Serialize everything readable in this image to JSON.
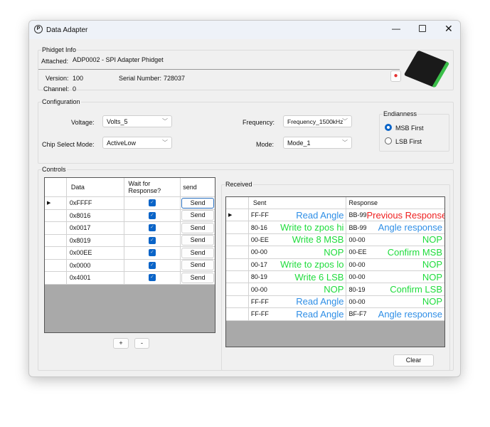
{
  "window": {
    "title": "Data Adapter",
    "controls": [
      "minimize",
      "maximize",
      "close"
    ]
  },
  "phidget_info": {
    "title": "Phidget Info",
    "attached_label": "Attached:",
    "attached": "ADP0002 - SPI Adapter Phidget",
    "version_label": "Version:",
    "version": "100",
    "serial_label": "Serial Number:",
    "serial": "728037",
    "channel_label": "Channel:",
    "channel": "0"
  },
  "configuration": {
    "title": "Configuration",
    "voltage_label": "Voltage:",
    "voltage": "Volts_5",
    "chip_select_label": "Chip Select Mode:",
    "chip_select": "ActiveLow",
    "frequency_label": "Frequency:",
    "frequency": "Frequency_1500kHz",
    "mode_label": "Mode:",
    "mode": "Mode_1",
    "endianness": {
      "title": "Endianness",
      "options": [
        "MSB First",
        "LSB First"
      ],
      "selected": "MSB First"
    }
  },
  "controls": {
    "title": "Controls",
    "columns": [
      "Data",
      "Wait for Response?",
      "send"
    ],
    "rows": [
      {
        "data": "0xFFFF",
        "wait": true,
        "button": "Send"
      },
      {
        "data": "0x8016",
        "wait": true,
        "button": "Send"
      },
      {
        "data": "0x0017",
        "wait": true,
        "button": "Send"
      },
      {
        "data": "0x8019",
        "wait": true,
        "button": "Send"
      },
      {
        "data": "0x00EE",
        "wait": true,
        "button": "Send"
      },
      {
        "data": "0x0000",
        "wait": true,
        "button": "Send"
      },
      {
        "data": "0x4001",
        "wait": true,
        "button": "Send"
      }
    ],
    "add_label": "+",
    "remove_label": "-"
  },
  "received": {
    "title": "Received",
    "columns": [
      "Sent",
      "Response"
    ],
    "colors": {
      "blue": "#2e8ee6",
      "green": "#1fdc3c",
      "red": "#ee2020"
    },
    "rows": [
      {
        "sent": "FF-FF",
        "sent_note": "Read Angle",
        "sent_color": "blue",
        "resp": "BB-99",
        "resp_note": "Previous Response",
        "resp_color": "red"
      },
      {
        "sent": "80-16",
        "sent_note": "Write to zpos hi",
        "sent_color": "green",
        "resp": "BB-99",
        "resp_note": "Angle response",
        "resp_color": "blue"
      },
      {
        "sent": "00-EE",
        "sent_note": "Write 8 MSB",
        "sent_color": "green",
        "resp": "00-00",
        "resp_note": "NOP",
        "resp_color": "green"
      },
      {
        "sent": "00-00",
        "sent_note": "NOP",
        "sent_color": "green",
        "resp": "00-EE",
        "resp_note": "Confirm MSB",
        "resp_color": "green"
      },
      {
        "sent": "00-17",
        "sent_note": "Write to zpos lo",
        "sent_color": "green",
        "resp": "00-00",
        "resp_note": "NOP",
        "resp_color": "green"
      },
      {
        "sent": "80-19",
        "sent_note": "Write 6 LSB",
        "sent_color": "green",
        "resp": "00-00",
        "resp_note": "NOP",
        "resp_color": "green"
      },
      {
        "sent": "00-00",
        "sent_note": "NOP",
        "sent_color": "green",
        "resp": "80-19",
        "resp_note": "Confirm LSB",
        "resp_color": "green"
      },
      {
        "sent": "FF-FF",
        "sent_note": "Read Angle",
        "sent_color": "blue",
        "resp": "00-00",
        "resp_note": "NOP",
        "resp_color": "green"
      },
      {
        "sent": "FF-FF",
        "sent_note": "Read Angle",
        "sent_color": "blue",
        "resp": "BF-F7",
        "resp_note": "Angle response",
        "resp_color": "blue"
      }
    ],
    "clear_label": "Clear"
  }
}
